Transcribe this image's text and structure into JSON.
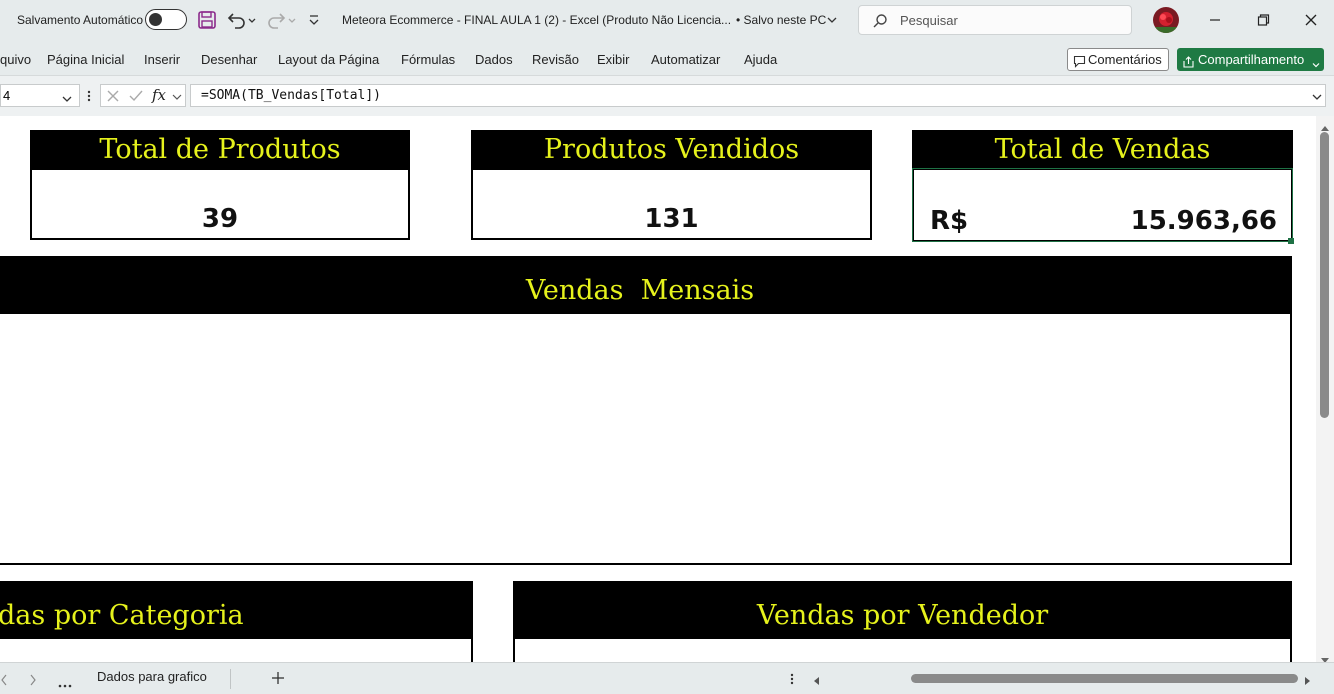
{
  "titlebar": {
    "autosave_label": "Salvamento Automático",
    "document_title": "Meteora Ecommerce - FINAL AULA 1 (2)  -  Excel (Produto Não Licencia...",
    "save_status": "• Salvo neste PC",
    "search_placeholder": "Pesquisar"
  },
  "ribbon": {
    "tabs": [
      "quivo",
      "Página Inicial",
      "Inserir",
      "Desenhar",
      "Layout da Página",
      "Fórmulas",
      "Dados",
      "Revisão",
      "Exibir",
      "Automatizar",
      "Ajuda"
    ],
    "comments_label": "Comentários",
    "share_label": "Compartilhamento"
  },
  "formula_bar": {
    "name_box": "4",
    "formula": "=SOMA(TB_Vendas[Total])"
  },
  "dashboard": {
    "total_produtos": {
      "title": "Total de Produtos",
      "value": "39"
    },
    "produtos_vendidos": {
      "title": "Produtos Vendidos",
      "value": "131"
    },
    "total_vendas": {
      "title": "Total de Vendas",
      "currency": "R$",
      "value": "15.963,66"
    },
    "vendas_mensais": {
      "title": "Vendas  Mensais"
    },
    "vendas_categoria": {
      "title": "das por Categoria"
    },
    "vendas_vendedor": {
      "title": "Vendas por Vendedor"
    }
  },
  "statusbar": {
    "sheet_tab": "Dados para grafico"
  },
  "colors": {
    "header_bg": "#000000",
    "header_text": "#e6f21c",
    "share_button": "#1f7a44",
    "chrome": "#e6ebec"
  }
}
